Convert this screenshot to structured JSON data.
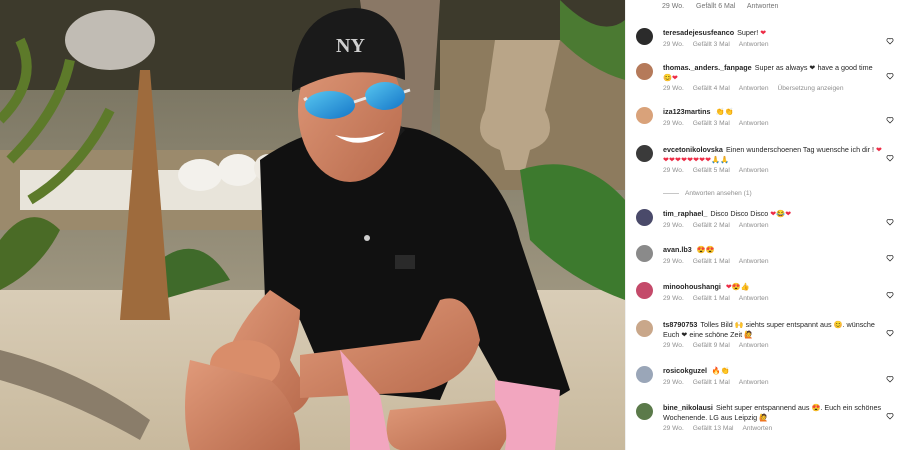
{
  "colors": {
    "heart": "#ed2b45",
    "meta": "#8e8e8e",
    "text": "#262626"
  },
  "top_meta": {
    "age": "29 Wo.",
    "likes": "Gefällt 6 Mal",
    "reply": "Antworten"
  },
  "replies_toggle": "Antworten ansehen (1)",
  "comments": [
    {
      "user": "teresadejesusfeanco",
      "text": "Super!",
      "emoji": "❤",
      "age": "29 Wo.",
      "likes": "Gefällt 3 Mal",
      "reply": "Antworten",
      "extra": ""
    },
    {
      "user": "thomas._anders._fanpage",
      "text": "Super as always ❤ have a good time",
      "emoji": "😊❤",
      "age": "29 Wo.",
      "likes": "Gefällt 4 Mal",
      "reply": "Antworten",
      "extra": "Übersetzung anzeigen"
    },
    {
      "user": "iza123martins",
      "text": "",
      "emoji": "👏👏",
      "age": "29 Wo.",
      "likes": "Gefällt 3 Mal",
      "reply": "Antworten",
      "extra": ""
    },
    {
      "user": "evcetonikolovska",
      "text": "Einen wunderschoenen Tag wuensche ich dir !",
      "emoji": "❤❤❤❤❤❤❤❤❤🙏🙏",
      "age": "29 Wo.",
      "likes": "Gefällt 5 Mal",
      "reply": "Antworten",
      "extra": ""
    },
    {
      "user": "tim_raphael_",
      "text": "Disco Disco Disco",
      "emoji": "❤😂❤",
      "age": "29 Wo.",
      "likes": "Gefällt 2 Mal",
      "reply": "Antworten",
      "extra": ""
    },
    {
      "user": "avan.lb3",
      "text": "",
      "emoji": "😍😍",
      "age": "29 Wo.",
      "likes": "Gefällt 1 Mal",
      "reply": "Antworten",
      "extra": ""
    },
    {
      "user": "minoohoushangi",
      "text": "",
      "emoji": "❤😍👍",
      "age": "29 Wo.",
      "likes": "Gefällt 1 Mal",
      "reply": "Antworten",
      "extra": ""
    },
    {
      "user": "ts8790753",
      "text": "Tolles Bild 🙌 siehts super entspannt aus 😊. wünsche Euch ❤ eine schöne Zeit 🙋",
      "emoji": "",
      "age": "29 Wo.",
      "likes": "Gefällt 9 Mal",
      "reply": "Antworten",
      "extra": ""
    },
    {
      "user": "rosicokguzel",
      "text": "",
      "emoji": "🔥👏",
      "age": "29 Wo.",
      "likes": "Gefällt 1 Mal",
      "reply": "Antworten",
      "extra": ""
    },
    {
      "user": "bine_nikolausi",
      "text": "Sieht super entspannend aus 😍. Euch ein schönes Wochenende. LG aus Leipzig 🙋",
      "emoji": "",
      "age": "29 Wo.",
      "likes": "Gefällt 13 Mal",
      "reply": "Antworten",
      "extra": ""
    }
  ]
}
